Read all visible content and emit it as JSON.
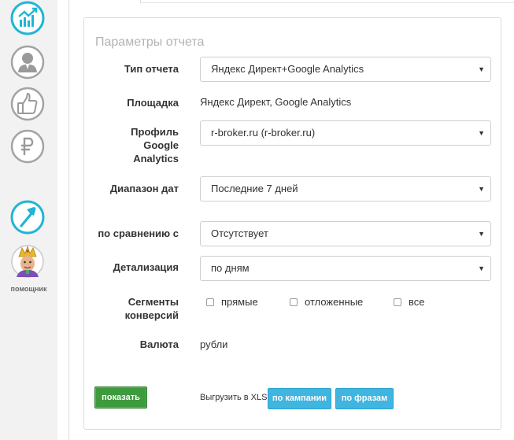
{
  "sidebar": {
    "items": [
      {
        "icon": "stats-chart-icon"
      },
      {
        "icon": "user-profile-icon"
      },
      {
        "icon": "thumbs-up-icon"
      },
      {
        "icon": "ruble-icon"
      },
      {
        "icon": "hammer-icon"
      },
      {
        "icon": "assistant-avatar-icon"
      }
    ],
    "assistant_label": "помощник"
  },
  "panel": {
    "title": "Параметры отчета",
    "report_type": {
      "label": "Тип отчета",
      "value": "Яндекс Директ+Google Analytics"
    },
    "platform": {
      "label": "Площадка",
      "value": "Яндекс Директ, Google Analytics"
    },
    "ga_profile": {
      "label_line1": "Профиль",
      "label_line2": "Google",
      "label_line3": "Analytics",
      "value": "r-broker.ru (r-broker.ru)"
    },
    "date_range": {
      "label": "Диапазон дат",
      "value": "Последние 7 дней"
    },
    "compare": {
      "label": "по сравнению с",
      "value": "Отсутствует"
    },
    "detail": {
      "label": "Детализация",
      "value": "по дням"
    },
    "segments": {
      "label_line1": "Сегменты",
      "label_line2": "конверсий",
      "options": [
        {
          "label": "прямые",
          "checked": false
        },
        {
          "label": "отложенные",
          "checked": false
        },
        {
          "label": "все",
          "checked": false
        }
      ]
    },
    "currency": {
      "label": "Валюта",
      "value": "рубли"
    },
    "show_button": "показать",
    "export_label": "Выгрузить в XLS",
    "export_by_campaign": "по кампании",
    "export_by_phrases": "по фразам"
  },
  "colors": {
    "accent_cyan": "#1fb5d6",
    "sidebar_gray": "#9a9a9a",
    "show_green": "#3d9a3d",
    "export_blue": "#3fb5e0"
  }
}
